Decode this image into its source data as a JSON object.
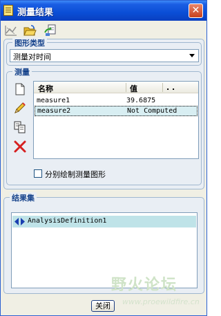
{
  "window": {
    "title": "测量结果"
  },
  "toolbar": {
    "buttons": [
      {
        "icon": "chart-icon"
      },
      {
        "icon": "open-folder-icon"
      },
      {
        "icon": "export-icon"
      }
    ]
  },
  "graph_type": {
    "group_label": "图形类型",
    "selected": "测量对时间"
  },
  "measure": {
    "group_label": "测量",
    "table": {
      "headers": [
        "名称",
        "值",
        ". ."
      ],
      "rows": [
        {
          "name": "measure1",
          "value": "39.6875",
          "selected": false
        },
        {
          "name": "measure2",
          "value": "Not Computed",
          "selected": true
        }
      ]
    },
    "side_tools": [
      "new-document-icon",
      "edit-pencil-icon",
      "copy-icon",
      "delete-icon"
    ],
    "checkbox_label": "分别绘制测量图形",
    "checkbox_checked": false
  },
  "results": {
    "group_label": "结果集",
    "items": [
      {
        "label": "AnalysisDefinition1"
      }
    ]
  },
  "footer": {
    "close_label": "关闭"
  },
  "watermark": {
    "text": "野火论坛",
    "url": "www.proewildfire.cn"
  },
  "colors": {
    "titlebar": "#0a4ed6",
    "group_title": "#15428b",
    "selected_row": "#d8eef2",
    "result_row": "#bfe3e8"
  }
}
